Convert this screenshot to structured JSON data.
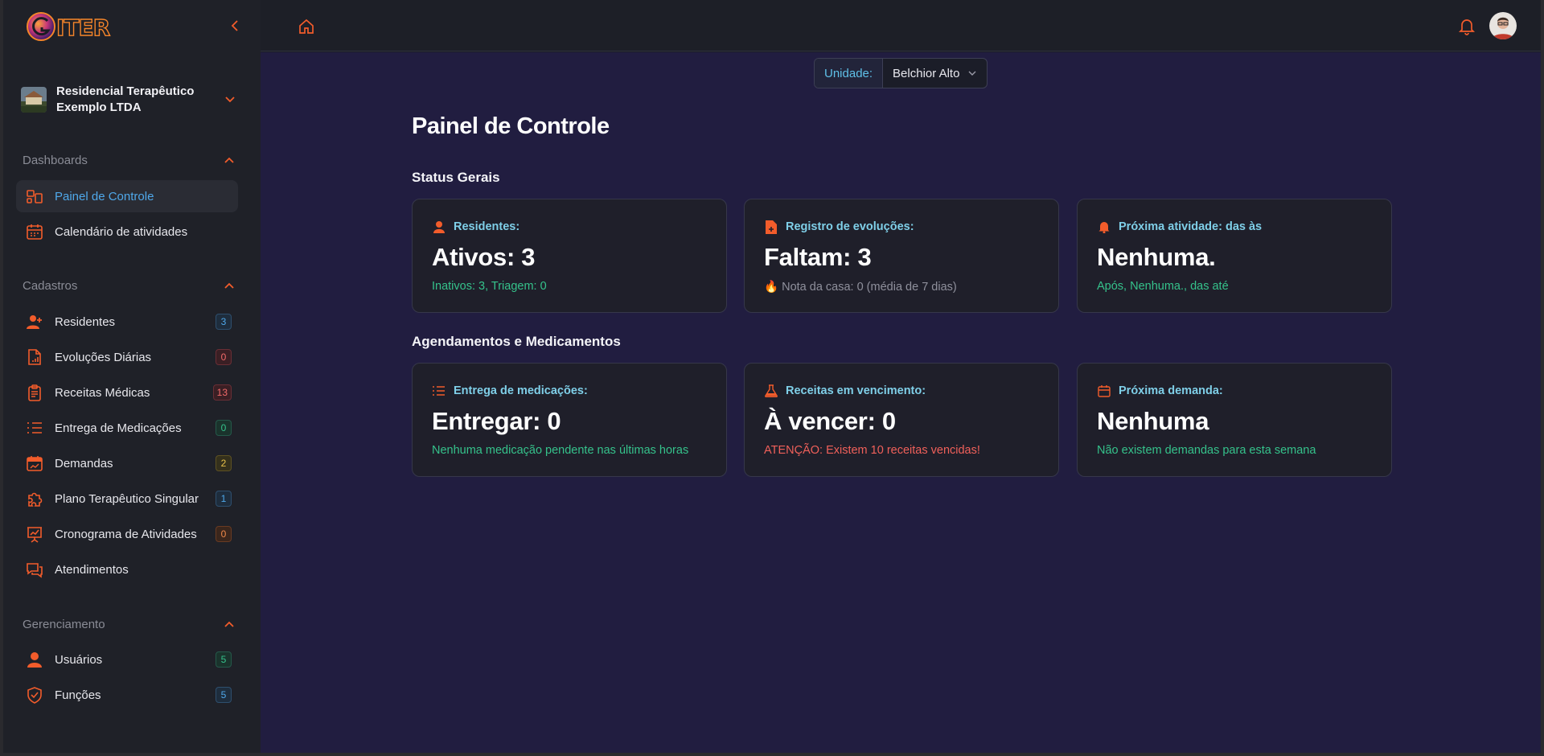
{
  "brand": {
    "logo_text": "GITER"
  },
  "org": {
    "name": "Residencial Terapêutico Exemplo LTDA"
  },
  "sections": {
    "dashboards": {
      "label": "Dashboards"
    },
    "cadastros": {
      "label": "Cadastros"
    },
    "gerenciamento": {
      "label": "Gerenciamento"
    }
  },
  "nav": {
    "painel": {
      "label": "Painel de Controle"
    },
    "calendario": {
      "label": "Calendário de atividades"
    },
    "residentes": {
      "label": "Residentes",
      "badge": "3"
    },
    "evolucoes": {
      "label": "Evoluções Diárias",
      "badge": "0"
    },
    "receitas": {
      "label": "Receitas Médicas",
      "badge": "13"
    },
    "entrega": {
      "label": "Entrega de Medicações",
      "badge": "0"
    },
    "demandas": {
      "label": "Demandas",
      "badge": "2"
    },
    "plano": {
      "label": "Plano Terapêutico Singular",
      "badge": "1"
    },
    "cronograma": {
      "label": "Cronograma de Atividades",
      "badge": "0"
    },
    "atendimentos": {
      "label": "Atendimentos"
    },
    "usuarios": {
      "label": "Usuários",
      "badge": "5"
    },
    "funcoes": {
      "label": "Funções",
      "badge": "5"
    }
  },
  "unit": {
    "label": "Unidade:",
    "value": "Belchior Alto"
  },
  "page": {
    "title": "Painel de Controle"
  },
  "groups": {
    "status": "Status Gerais",
    "agendamentos": "Agendamentos e Medicamentos"
  },
  "cards": {
    "residentes": {
      "title": "Residentes:",
      "value": "Ativos: 3",
      "sub": "Inativos: 3, Triagem: 0"
    },
    "evolucoes": {
      "title": "Registro de evoluções:",
      "value": "Faltam: 3",
      "sub": "Nota da casa: 0 (média de 7 dias)"
    },
    "atividade": {
      "title": "Próxima atividade: das às",
      "value": "Nenhuma.",
      "sub": "Após, Nenhuma., das até"
    },
    "medicacoes": {
      "title": "Entrega de medicações:",
      "value": "Entregar: 0",
      "sub": "Nenhuma medicação pendente nas últimas horas"
    },
    "receitas": {
      "title": "Receitas em vencimento:",
      "value": "À vencer: 0",
      "sub": "ATENÇÃO: Existem 10 receitas vencidas!"
    },
    "demanda": {
      "title": "Próxima demanda:",
      "value": "Nenhuma",
      "sub": "Não existem demandas para esta semana"
    }
  },
  "colors": {
    "accent": "#f25c2b",
    "active_link": "#4fa8ea",
    "card_title": "#7fcfe8",
    "success": "#35c28b",
    "danger": "#f0605a",
    "main_bg": "#211d40",
    "sidebar_bg": "#1f2128"
  },
  "icons": [
    "logo",
    "chevron-left-icon",
    "chevron-down-icon",
    "chevron-up-icon",
    "dashboard-icon",
    "calendar-icon",
    "user-plus-icon",
    "file-chart-icon",
    "clipboard-icon",
    "list-icon",
    "calendar-chart-icon",
    "puzzle-icon",
    "presentation-chart-icon",
    "chat-icon",
    "user-icon",
    "shield-check-icon",
    "home-icon",
    "bell-icon",
    "file-icon",
    "flask-icon",
    "fire-icon"
  ]
}
